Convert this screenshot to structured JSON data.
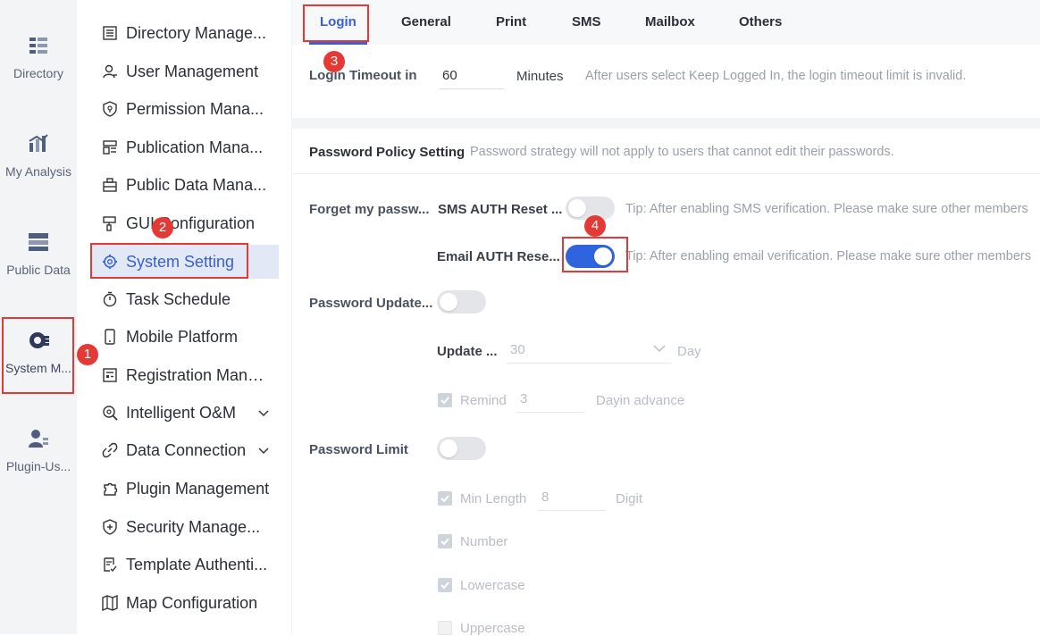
{
  "rail": {
    "items": [
      {
        "label": "Directory",
        "icon": "directory-icon"
      },
      {
        "label": "My Analysis",
        "icon": "analysis-chart-icon"
      },
      {
        "label": "Public Data",
        "icon": "database-icon"
      },
      {
        "label": "System M...",
        "icon": "system-gear-icon"
      },
      {
        "label": "Plugin-Us...",
        "icon": "plugin-user-icon"
      }
    ]
  },
  "menu": {
    "items": [
      {
        "label": "Directory Manage...",
        "icon": "list-doc-icon"
      },
      {
        "label": "User Management",
        "icon": "user-icon"
      },
      {
        "label": "Permission Mana...",
        "icon": "shield-icon"
      },
      {
        "label": "Publication Mana...",
        "icon": "layout-icon"
      },
      {
        "label": "Public Data Mana...",
        "icon": "box-icon"
      },
      {
        "label": "GUI Configuration",
        "icon": "brush-icon"
      },
      {
        "label": "System Setting",
        "icon": "gear-icon"
      },
      {
        "label": "Task Schedule",
        "icon": "timer-icon"
      },
      {
        "label": "Mobile Platform",
        "icon": "mobile-icon"
      },
      {
        "label": "Registration Mana...",
        "icon": "register-icon"
      },
      {
        "label": "Intelligent O&M",
        "icon": "wrench-icon"
      },
      {
        "label": "Data Connection",
        "icon": "link-icon"
      },
      {
        "label": "Plugin Management",
        "icon": "puzzle-icon"
      },
      {
        "label": "Security Manage...",
        "icon": "security-shield-icon"
      },
      {
        "label": "Template Authenti...",
        "icon": "template-icon"
      },
      {
        "label": "Map Configuration",
        "icon": "map-icon"
      }
    ]
  },
  "tabs": [
    "Login",
    "General",
    "Print",
    "SMS",
    "Mailbox",
    "Others"
  ],
  "login_timeout": {
    "label": "Login Timeout in",
    "value": "60",
    "unit": "Minutes",
    "hint": "After users select Keep Logged In, the login timeout limit is invalid."
  },
  "password_policy": {
    "title": "Password Policy Setting",
    "desc": "Password strategy will not apply to users that cannot edit their passwords."
  },
  "forget_password": {
    "label": "Forget my passw...",
    "sms_label": "SMS AUTH Reset ...",
    "sms_on": false,
    "sms_tip": "Tip: After enabling SMS verification. Please make sure other members",
    "email_label": "Email AUTH Rese...",
    "email_on": true,
    "email_tip": "Tip: After enabling email verification. Please make sure other members"
  },
  "password_update": {
    "label": "Password Update...",
    "on": false,
    "update_label": "Update ...",
    "update_value": "30",
    "update_unit": "Day",
    "remind_label": "Remind",
    "remind_value": "3",
    "remind_unit": "Dayin advance"
  },
  "password_limit": {
    "label": "Password Limit",
    "on": false,
    "min_length_label": "Min Length",
    "min_length_value": "8",
    "min_length_unit": "Digit",
    "number_label": "Number",
    "lowercase_label": "Lowercase",
    "uppercase_label": "Uppercase"
  },
  "annotations": [
    "1",
    "2",
    "3",
    "4"
  ],
  "colors": {
    "accent": "#3860d6",
    "annotation": "#e53935",
    "toggle_on": "#3063de"
  }
}
